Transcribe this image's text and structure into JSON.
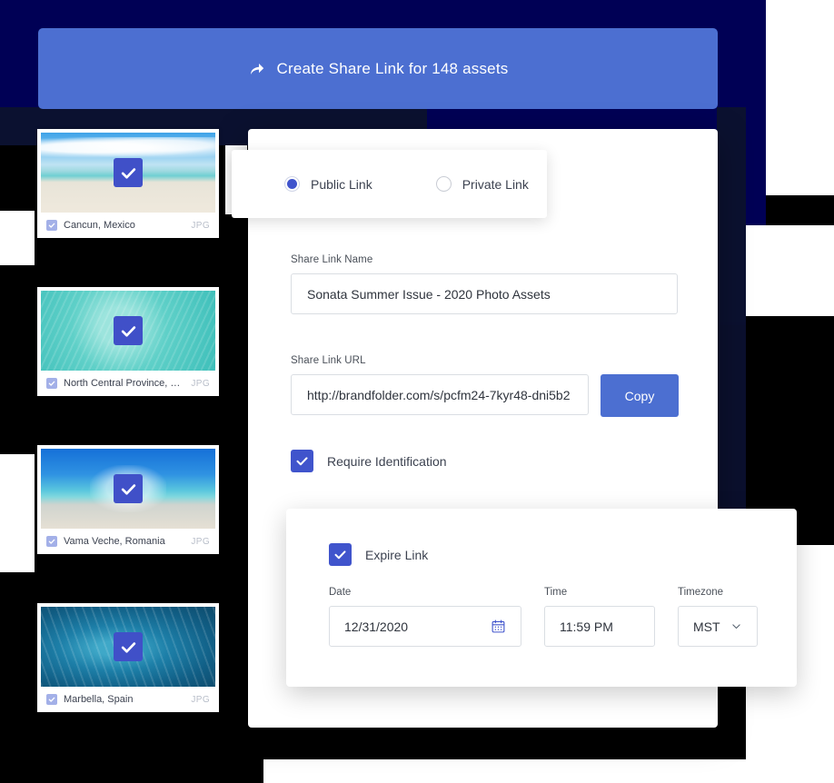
{
  "header": {
    "cta_label": "Create Share Link for 148 assets",
    "cta_icon": "share-arrow-icon",
    "asset_count": "148",
    "background_color": "#4c6fd1"
  },
  "page": {
    "navy_color": "#000055",
    "accent_color": "#4054cc",
    "button_color": "#4c6fd1"
  },
  "link_type": {
    "options": [
      {
        "label": "Public Link",
        "selected": true
      },
      {
        "label": "Private Link",
        "selected": false
      }
    ]
  },
  "share_link_name": {
    "label": "Share Link Name",
    "value": "Sonata Summer Issue  -  2020 Photo Assets"
  },
  "share_link_url": {
    "label": "Share Link URL",
    "value": "http://brandfolder.com/s/pcfm24-7kyr48-dni5b2",
    "copy_label": "Copy"
  },
  "require_identification": {
    "label": "Require Identification",
    "checked": true
  },
  "expire_link": {
    "label": "Expire Link",
    "checked": true,
    "date": {
      "label": "Date",
      "value": "12/31/2020",
      "icon": "calendar-icon"
    },
    "time": {
      "label": "Time",
      "value": "11:59 PM"
    },
    "timezone": {
      "label": "Timezone",
      "value": "MST",
      "icon": "chevron-down-icon"
    }
  },
  "assets": [
    {
      "name": "Cancun, Mexico",
      "ext": "JPG",
      "selected": true,
      "photo": "ph-cancun"
    },
    {
      "name": "North Central Province, Maldiv...",
      "ext": "JPG",
      "selected": true,
      "photo": "ph-maldives"
    },
    {
      "name": "Vama Veche, Romania",
      "ext": "JPG",
      "selected": true,
      "photo": "ph-vama"
    },
    {
      "name": "Marbella, Spain",
      "ext": "JPG",
      "selected": true,
      "photo": "ph-marbella"
    }
  ]
}
